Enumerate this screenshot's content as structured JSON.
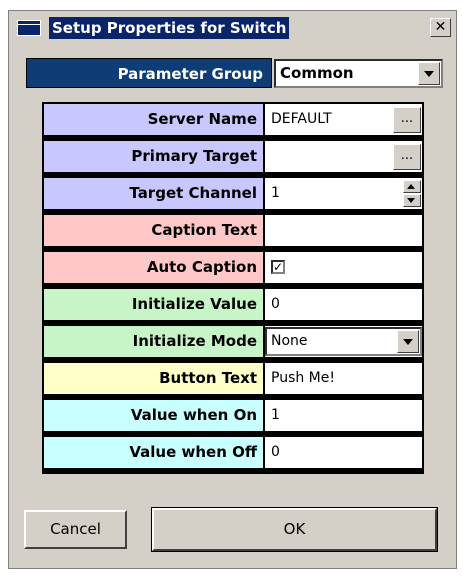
{
  "window": {
    "title": "Setup Properties for Switch",
    "close_label": "✕"
  },
  "parameter_group": {
    "label": "Parameter Group",
    "value": "Common"
  },
  "properties": [
    {
      "label": "Server Name",
      "value": "DEFAULT",
      "color": "#c8c8ff",
      "control": "ellipsis"
    },
    {
      "label": "Primary Target",
      "value": "",
      "color": "#c8c8ff",
      "control": "ellipsis"
    },
    {
      "label": "Target Channel",
      "value": "1",
      "color": "#c8c8ff",
      "control": "spin"
    },
    {
      "label": "Caption Text",
      "value": "",
      "color": "#ffc8c8",
      "control": "text"
    },
    {
      "label": "Auto Caption",
      "value": "✓",
      "color": "#ffc8c8",
      "control": "checkbox",
      "checked": true
    },
    {
      "label": "Initialize Value",
      "value": "0",
      "color": "#c8f5c8",
      "control": "text"
    },
    {
      "label": "Initialize Mode",
      "value": "None",
      "color": "#c8f5c8",
      "control": "select"
    },
    {
      "label": "Button Text",
      "value": "Push Me!",
      "color": "#ffffc8",
      "control": "text"
    },
    {
      "label": "Value when On",
      "value": "1",
      "color": "#c8ffff",
      "control": "text"
    },
    {
      "label": "Value when Off",
      "value": "0",
      "color": "#c8ffff",
      "control": "text"
    }
  ],
  "buttons": {
    "cancel": "Cancel",
    "ok": "OK",
    "ellipsis": "..."
  }
}
